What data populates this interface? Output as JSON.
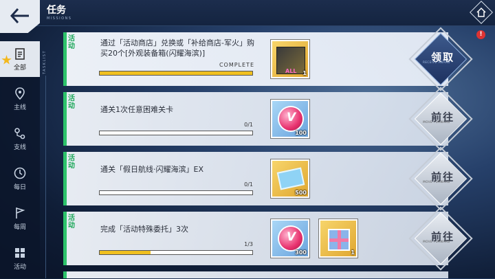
{
  "header": {
    "title": "任务",
    "subtitle": "MISSIONS",
    "vertical_label": "TASKLIST"
  },
  "sidebar": {
    "items": [
      {
        "label": "全部",
        "icon": "clipboard-icon",
        "active": true
      },
      {
        "label": "主线",
        "icon": "map-pin-icon",
        "active": false
      },
      {
        "label": "支线",
        "icon": "route-icon",
        "active": false
      },
      {
        "label": "每日",
        "icon": "clock-icon",
        "active": false
      },
      {
        "label": "每周",
        "icon": "flag-icon",
        "active": false
      },
      {
        "label": "活动",
        "icon": "grid-icon",
        "active": false
      }
    ]
  },
  "tasks": [
    {
      "category": "活动",
      "description": "通过「活动商店」兑换或「补给商店-军火」购买20个[外观装备箱(闪耀海滨)]",
      "status": "COMPLETE",
      "progress": 1.0,
      "rewards": [
        {
          "icon": "equipment-box-icon",
          "count": "1"
        }
      ],
      "action": {
        "label": "领取",
        "sub": "RECEIVE AWARD"
      }
    },
    {
      "category": "活动",
      "description": "通关1次任意困难关卡",
      "status": "0/1",
      "progress": 0,
      "rewards": [
        {
          "icon": "pink-gem-icon",
          "count": "100"
        }
      ],
      "action": {
        "label": "前往",
        "sub": "MOVE FORWARD"
      }
    },
    {
      "category": "活动",
      "description": "通关「假日航线·闪耀海滨」EX",
      "status": "0/1",
      "progress": 0,
      "rewards": [
        {
          "icon": "ticket-icon",
          "count": "500"
        }
      ],
      "action": {
        "label": "前往",
        "sub": "MOVE FORWARD"
      }
    },
    {
      "category": "活动",
      "description": "完成「活动特殊委托」3次",
      "status": "1/3",
      "progress": 0.333,
      "rewards": [
        {
          "icon": "pink-gem-icon",
          "count": "300"
        },
        {
          "icon": "gift-box-icon",
          "count": "1"
        }
      ],
      "action": {
        "label": "前往",
        "sub": "MOVE FORWARD"
      }
    }
  ],
  "alert_badge": "!",
  "colors": {
    "accent_green": "#2cc26a",
    "progress_fill": "#f0c020",
    "sidebar_active": "#e2e7ee"
  }
}
